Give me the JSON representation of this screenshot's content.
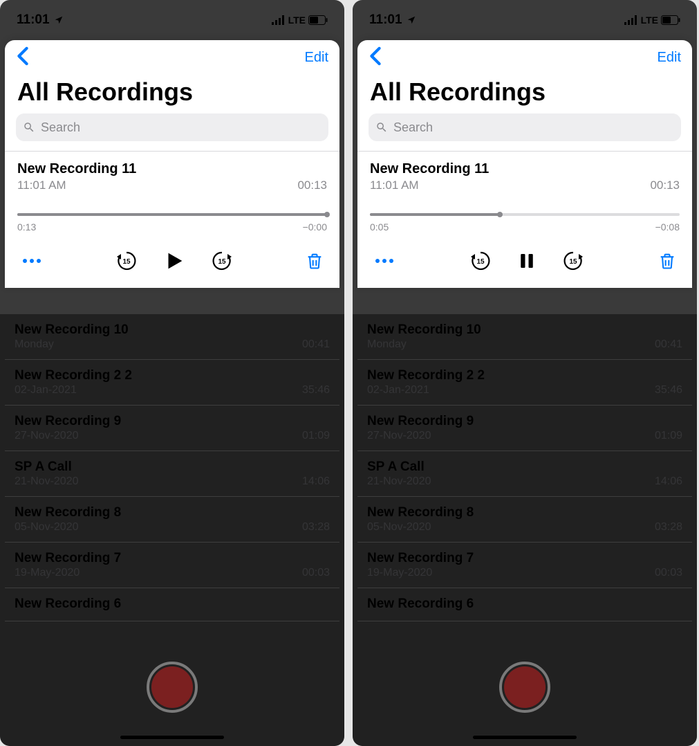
{
  "left": {
    "status": {
      "time": "11:01",
      "carrier_text": "LTE"
    },
    "nav": {
      "edit": "Edit"
    },
    "title": "All Recordings",
    "search": {
      "placeholder": "Search"
    },
    "expanded": {
      "title": "New Recording 11",
      "time": "11:01 AM",
      "duration": "00:13",
      "elapsed": "0:13",
      "remaining": "−0:00",
      "progress_pct": 100,
      "state": "paused"
    },
    "recordings": [
      {
        "title": "New Recording 10",
        "date": "Monday",
        "duration": "00:41"
      },
      {
        "title": "New Recording 2 2",
        "date": "02-Jan-2021",
        "duration": "35:46"
      },
      {
        "title": "New Recording 9",
        "date": "27-Nov-2020",
        "duration": "01:09"
      },
      {
        "title": "SP A Call",
        "date": "21-Nov-2020",
        "duration": "14:06"
      },
      {
        "title": "New Recording 8",
        "date": "05-Nov-2020",
        "duration": "03:28"
      },
      {
        "title": "New Recording 7",
        "date": "19-May-2020",
        "duration": "00:03"
      },
      {
        "title": "New Recording 6",
        "date": "",
        "duration": ""
      }
    ]
  },
  "right": {
    "status": {
      "time": "11:01",
      "carrier_text": "LTE"
    },
    "nav": {
      "edit": "Edit"
    },
    "title": "All Recordings",
    "search": {
      "placeholder": "Search"
    },
    "expanded": {
      "title": "New Recording 11",
      "time": "11:01 AM",
      "duration": "00:13",
      "elapsed": "0:05",
      "remaining": "−0:08",
      "progress_pct": 42,
      "state": "playing"
    },
    "recordings": [
      {
        "title": "New Recording 10",
        "date": "Monday",
        "duration": "00:41"
      },
      {
        "title": "New Recording 2 2",
        "date": "02-Jan-2021",
        "duration": "35:46"
      },
      {
        "title": "New Recording 9",
        "date": "27-Nov-2020",
        "duration": "01:09"
      },
      {
        "title": "SP A Call",
        "date": "21-Nov-2020",
        "duration": "14:06"
      },
      {
        "title": "New Recording 8",
        "date": "05-Nov-2020",
        "duration": "03:28"
      },
      {
        "title": "New Recording 7",
        "date": "19-May-2020",
        "duration": "00:03"
      },
      {
        "title": "New Recording 6",
        "date": "",
        "duration": ""
      }
    ]
  }
}
